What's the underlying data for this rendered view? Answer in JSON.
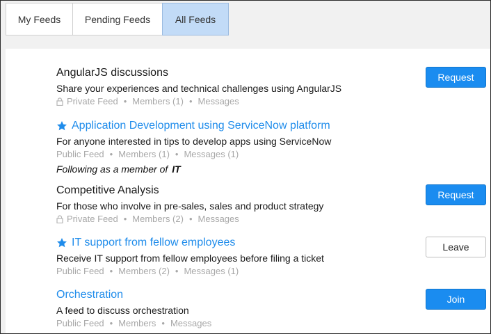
{
  "tabs": [
    {
      "label": "My Feeds",
      "active": false
    },
    {
      "label": "Pending Feeds",
      "active": false
    },
    {
      "label": "All Feeds",
      "active": true
    }
  ],
  "feeds": [
    {
      "title": "AngularJS discussions",
      "starred": false,
      "description": "Share your experiences and technical challenges using AngularJS",
      "type": "Private Feed",
      "members": "Members (1)",
      "messages": "Messages",
      "action": "Request"
    },
    {
      "title": "Application Development using ServiceNow platform",
      "starred": true,
      "description": "For anyone interested in tips to develop apps using ServiceNow",
      "type": "Public Feed",
      "members": "Members (1)",
      "messages": "Messages (1)",
      "following_prefix": "Following as a member of",
      "following_group": "IT"
    },
    {
      "title": "Competitive Analysis",
      "starred": false,
      "description": "For those who involve in pre-sales, sales and product strategy",
      "type": "Private Feed",
      "members": "Members (2)",
      "messages": "Messages",
      "action": "Request"
    },
    {
      "title": "IT support from fellow employees",
      "starred": true,
      "description": "Receive IT support from fellow employees before filing a ticket",
      "type": "Public Feed",
      "members": "Members (2)",
      "messages": "Messages (1)",
      "action": "Leave"
    },
    {
      "title": "Orchestration",
      "starred": false,
      "description": "A feed to discuss orchestration",
      "type": "Public Feed",
      "members": "Members",
      "messages": "Messages",
      "action": "Join"
    }
  ],
  "separator": "•",
  "colors": {
    "link": "#1f8ceb",
    "primary_button": "#1a8cf0",
    "active_tab": "#c2dbf7",
    "meta_text": "#a8a8a8"
  },
  "icons": {
    "star": "star-icon",
    "lock": "lock-icon"
  }
}
